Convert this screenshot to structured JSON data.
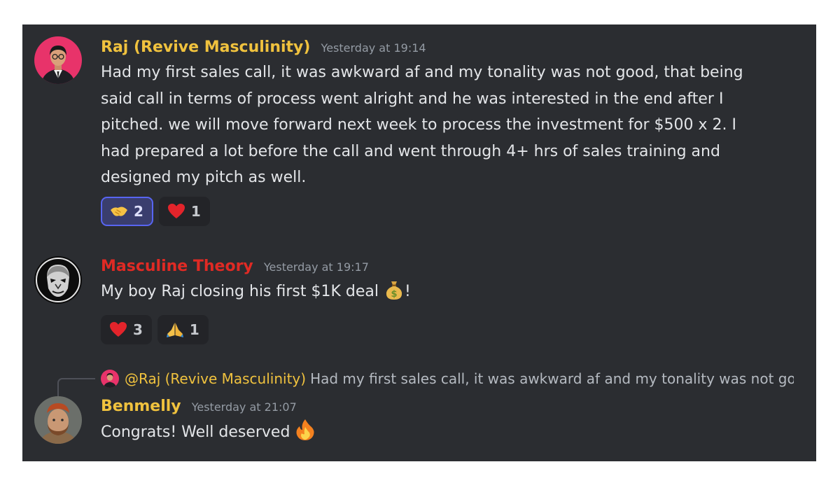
{
  "colors": {
    "background": "#2b2d31",
    "gold_name": "#f0c23e",
    "red_name": "#e02a24",
    "text": "#e3e5e8",
    "timestamp": "#949ba4",
    "reaction_active_border": "#5865f2"
  },
  "messages": [
    {
      "author": "Raj  (Revive Masculinity)",
      "timestamp": "Yesterday at 19:14",
      "lines": [
        "Had my first sales call, it was awkward af and my tonality was not good, that being",
        "said call in terms of process went alright and he was interested in the end after I",
        "pitched. we will move forward next week to process the investment for $500 x 2.  I",
        "had prepared a lot before the call and went through 4+ hrs of sales training and",
        "designed my pitch as well."
      ],
      "reactions": [
        {
          "emoji": "handshake-emoji",
          "count": "2",
          "active": true
        },
        {
          "emoji": "red-heart-emoji",
          "count": "1",
          "active": false
        }
      ]
    },
    {
      "author": "Masculine Theory",
      "timestamp": "Yesterday at 19:17",
      "text_before": "My boy Raj closing his first $1K deal ",
      "inline_emoji": "money-bag-emoji",
      "text_after": "!",
      "reactions": [
        {
          "emoji": "red-heart-emoji",
          "count": "3",
          "active": false
        },
        {
          "emoji": "folded-hands-emoji",
          "count": "1",
          "active": false
        }
      ]
    },
    {
      "reply_to": {
        "mention": "@Raj  (Revive Masculinity)",
        "excerpt": "Had my first sales call, it was awkward af and my tonality was not good"
      },
      "author": "Benmelly",
      "timestamp": "Yesterday at 21:07",
      "text_before": "Congrats! Well deserved ",
      "inline_emoji": "fire-emoji"
    }
  ]
}
